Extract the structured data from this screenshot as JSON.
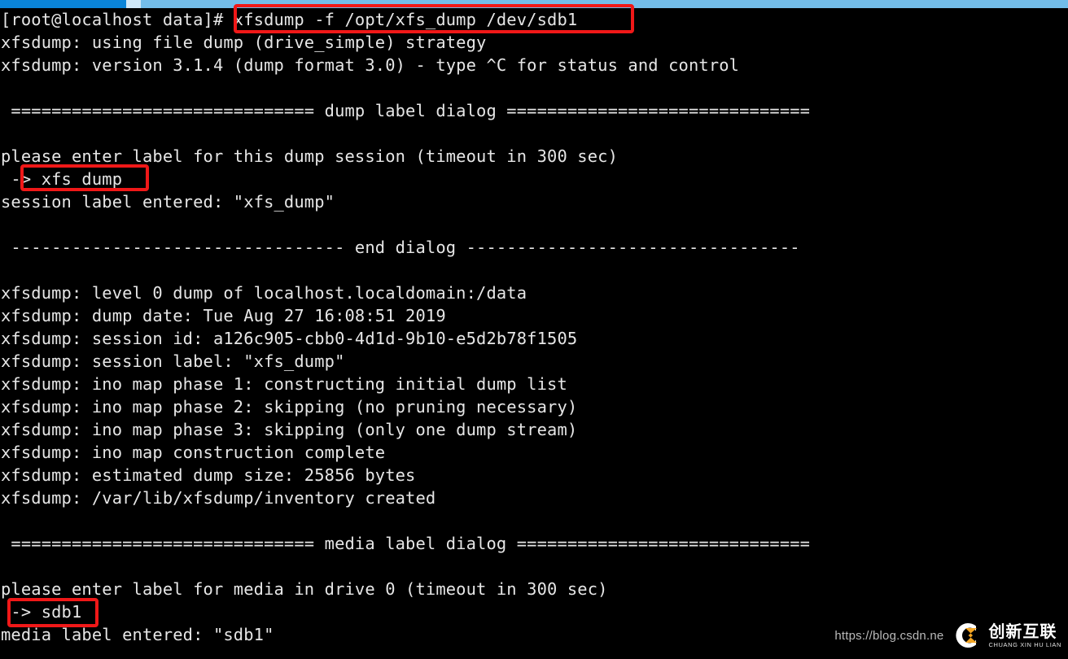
{
  "window": {
    "kind": "terminal-console",
    "background_color": "#000000",
    "text_color": "#e6e6e6"
  },
  "topbar": {
    "progress_color": "#0a84d8",
    "track_color": "#73bdea",
    "marker_color": "#cfe8f8"
  },
  "terminal": {
    "prompt": "[root@localhost data]#",
    "command": " xfsdump -f /opt/xfs_dump /dev/sdb1",
    "lines": [
      "[root@localhost data]# xfsdump -f /opt/xfs_dump /dev/sdb1",
      "xfsdump: using file dump (drive_simple) strategy",
      "xfsdump: version 3.1.4 (dump format 3.0) - type ^C for status and control",
      "",
      " ============================== dump label dialog ==============================",
      "",
      "please enter label for this dump session (timeout in 300 sec)",
      " -> xfs_dump",
      "session label entered: \"xfs_dump\"",
      "",
      " --------------------------------- end dialog ---------------------------------",
      "",
      "xfsdump: level 0 dump of localhost.localdomain:/data",
      "xfsdump: dump date: Tue Aug 27 16:08:51 2019",
      "xfsdump: session id: a126c905-cbb0-4d1d-9b10-e5d2b78f1505",
      "xfsdump: session label: \"xfs_dump\"",
      "xfsdump: ino map phase 1: constructing initial dump list",
      "xfsdump: ino map phase 2: skipping (no pruning necessary)",
      "xfsdump: ino map phase 3: skipping (only one dump stream)",
      "xfsdump: ino map construction complete",
      "xfsdump: estimated dump size: 25856 bytes",
      "xfsdump: /var/lib/xfsdump/inventory created",
      "",
      " ============================== media label dialog =============================",
      "",
      "please enter label for media in drive 0 (timeout in 300 sec)",
      " -> sdb1",
      "media label entered: \"sdb1\""
    ]
  },
  "annotations": {
    "color": "#f01818",
    "boxes": [
      {
        "name": "command-highlight",
        "target": "xfsdump -f /opt/xfs_dump /dev/sdb1"
      },
      {
        "name": "session-label-input-highlight",
        "target": "-> xfs_dump"
      },
      {
        "name": "media-label-input-highlight",
        "target": "-> sdb1"
      }
    ]
  },
  "watermark": {
    "url": "https://blog.csdn.ne",
    "logo_cn": "创新互联",
    "logo_pinyin": "CHUANG XIN HU LIAN",
    "logo_accent": "#f5a623"
  }
}
